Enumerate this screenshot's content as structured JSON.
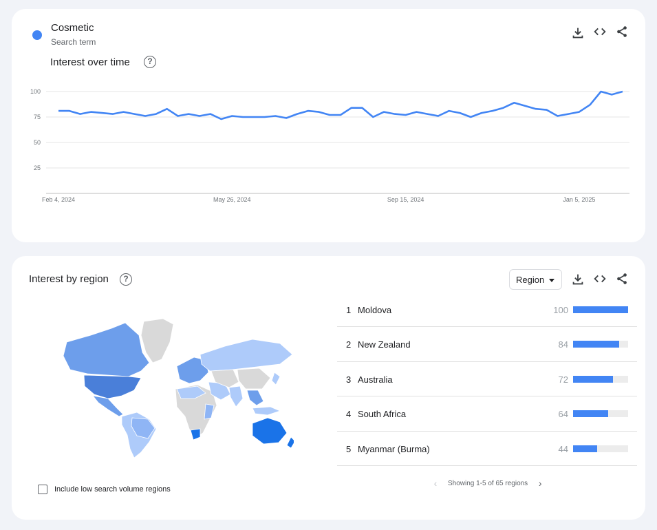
{
  "term": {
    "name": "Cosmetic",
    "subtitle": "Search term",
    "color": "#4285f4"
  },
  "time_section": {
    "title": "Interest over time"
  },
  "chart_data": {
    "type": "line",
    "title": "Interest over time",
    "ylim": [
      0,
      100
    ],
    "yticks": [
      25,
      50,
      75,
      100
    ],
    "xticks": [
      "Feb 4, 2024",
      "May 26, 2024",
      "Sep 15, 2024",
      "Jan 5, 2025"
    ],
    "grid": true,
    "series": [
      {
        "name": "Cosmetic",
        "color": "#4285f4",
        "x_start": "Feb 4, 2024",
        "x_end": "Feb 2, 2025",
        "interval": "weekly",
        "values": [
          81,
          81,
          78,
          80,
          79,
          78,
          80,
          78,
          76,
          78,
          83,
          76,
          78,
          76,
          78,
          73,
          76,
          75,
          75,
          75,
          76,
          74,
          78,
          81,
          80,
          77,
          77,
          84,
          84,
          75,
          80,
          78,
          77,
          80,
          78,
          76,
          81,
          79,
          75,
          79,
          81,
          84,
          89,
          86,
          83,
          82,
          76,
          78,
          80,
          87,
          100,
          97,
          100
        ]
      }
    ]
  },
  "region_section": {
    "title": "Interest by region",
    "dropdown": "Region",
    "include_low_label": "Include low search volume regions",
    "pager_text": "Showing 1-5 of 65 regions",
    "ranks": [
      {
        "rank": "1",
        "name": "Moldova",
        "value": 100
      },
      {
        "rank": "2",
        "name": "New Zealand",
        "value": 84
      },
      {
        "rank": "3",
        "name": "Australia",
        "value": 72
      },
      {
        "rank": "4",
        "name": "South Africa",
        "value": 64
      },
      {
        "rank": "5",
        "name": "Myanmar (Burma)",
        "value": 44
      }
    ]
  },
  "icons": {
    "download": "download-icon",
    "embed": "embed-code-icon",
    "share": "share-icon",
    "help": "help-icon"
  },
  "help_glyph": "?",
  "map_colors": {
    "no_data": "#d9d9d9",
    "low": "#aecbfa",
    "mid": "#6d9eeb",
    "high": "#1a73e8"
  }
}
